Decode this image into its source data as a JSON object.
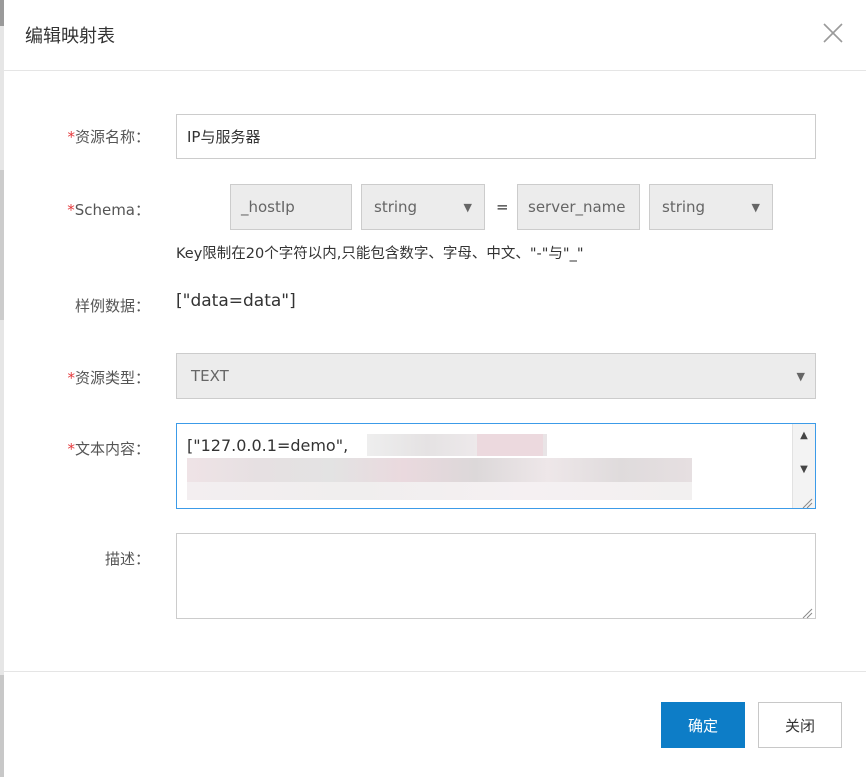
{
  "dialog": {
    "title": "编辑映射表"
  },
  "form": {
    "resource_name": {
      "label": "资源名称：",
      "value": "IP与服务器"
    },
    "schema": {
      "label": "Schema：",
      "key_field": "_hostIp",
      "key_type": "string",
      "equals": "=",
      "value_field": "server_name",
      "value_type": "string",
      "hint": "Key限制在20个字符以内,只能包含数字、字母、中文、\"-\"与\"_\""
    },
    "sample": {
      "label": "样例数据：",
      "value": "[\"data=data\"]"
    },
    "resource_type": {
      "label": "资源类型：",
      "value": "TEXT"
    },
    "text_content": {
      "label": "文本内容：",
      "value": "[\"127.0.0.1=demo\","
    },
    "description": {
      "label": "描述：",
      "value": ""
    },
    "required_mark": "*"
  },
  "buttons": {
    "confirm": "确定",
    "close": "关闭"
  },
  "colors": {
    "primary": "#0d7dc7",
    "required": "#e4393c",
    "focus": "#3c9be8"
  },
  "icons": [
    "close-icon",
    "chevron-down-icon",
    "scroll-up-icon",
    "scroll-down-icon",
    "resize-grip-icon"
  ]
}
